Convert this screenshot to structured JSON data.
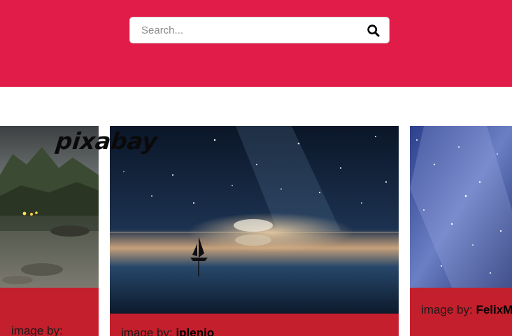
{
  "search": {
    "placeholder": "Search...",
    "value": ""
  },
  "logo": {
    "text": "pixabay"
  },
  "cards": [
    {
      "credit_prefix": "image by: ",
      "author": ""
    },
    {
      "credit_prefix": "image by: ",
      "author": "jplenio"
    },
    {
      "credit_prefix": "image by: ",
      "author": "FelixM"
    }
  ],
  "colors": {
    "header": "#e21c48",
    "card_footer": "#c41f2c"
  },
  "icons": {
    "search": "search-icon"
  }
}
